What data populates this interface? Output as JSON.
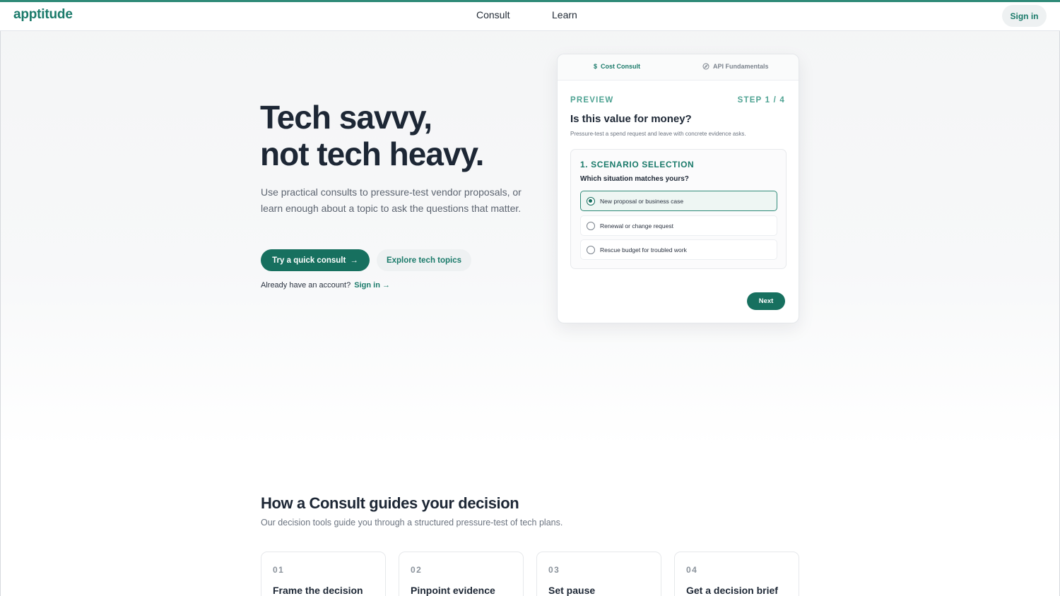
{
  "brand": {
    "logo": "apptitude",
    "accent": "#1a7a6a",
    "primary_button": "#17705f"
  },
  "nav": {
    "links": [
      {
        "label": "Consult"
      },
      {
        "label": "Learn"
      }
    ],
    "signin_label": "Sign in"
  },
  "hero": {
    "title_line1": "Tech savvy,",
    "title_line2": "not tech heavy.",
    "subtitle": "Use practical consults to pressure-test vendor proposals, or learn enough about a topic to ask the questions that matter.",
    "primary_cta": "Try a quick consult",
    "secondary_cta": "Explore tech topics",
    "account_prompt": "Already have an account?",
    "account_link": "Sign in"
  },
  "preview_card": {
    "tabs": [
      {
        "label": "Cost Consult",
        "icon": "dollar-icon",
        "active": true
      },
      {
        "label": "API Fundamentals",
        "icon": "compass-icon",
        "active": false
      }
    ],
    "label": "PREVIEW",
    "step": "STEP 1 / 4",
    "question": "Is this value for money?",
    "description": "Pressure-test a spend request and leave with concrete evidence asks.",
    "section_title": "1. SCENARIO SELECTION",
    "section_question": "Which situation matches yours?",
    "options": [
      {
        "label": "New proposal or business case",
        "selected": true
      },
      {
        "label": "Renewal or change request",
        "selected": false
      },
      {
        "label": "Rescue budget for troubled work",
        "selected": false
      }
    ],
    "next_label": "Next"
  },
  "how": {
    "title": "How a Consult guides your decision",
    "subtitle": "Our decision tools guide you through a structured pressure-test of tech plans.",
    "steps": [
      {
        "number": "01",
        "name": "Frame the decision"
      },
      {
        "number": "02",
        "name": "Pinpoint evidence"
      },
      {
        "number": "03",
        "name": "Set pause"
      },
      {
        "number": "04",
        "name": "Get a decision brief"
      }
    ]
  }
}
